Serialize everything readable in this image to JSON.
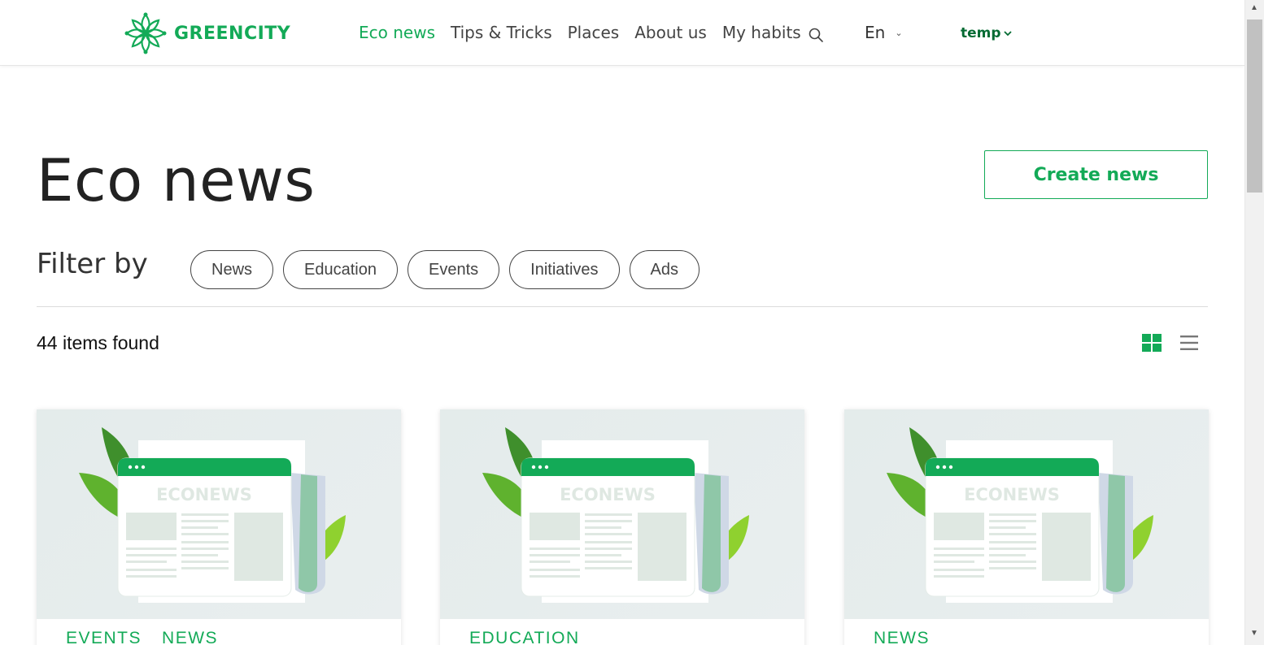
{
  "header": {
    "logo_text": "GREENCITY",
    "nav": [
      {
        "label": "Eco news",
        "active": true
      },
      {
        "label": "Tips & Tricks",
        "active": false
      },
      {
        "label": "Places",
        "active": false
      },
      {
        "label": "About us",
        "active": false
      },
      {
        "label": "My habits",
        "active": false
      }
    ],
    "language": "En",
    "user": "temp"
  },
  "main": {
    "title": "Eco news",
    "create_label": "Create news",
    "filter_label": "Filter by",
    "filters": [
      "News",
      "Education",
      "Events",
      "Initiatives",
      "Ads"
    ],
    "items_found": "44 items found",
    "view_modes": {
      "grid_active": true
    }
  },
  "cards": [
    {
      "image_text": "ECONEWS",
      "tags": [
        "EVENTS",
        "NEWS"
      ]
    },
    {
      "image_text": "ECONEWS",
      "tags": [
        "EDUCATION"
      ]
    },
    {
      "image_text": "ECONEWS",
      "tags": [
        "NEWS"
      ]
    }
  ],
  "colors": {
    "accent": "#13aa57",
    "accent_dark": "#056b33",
    "text": "#222222"
  }
}
